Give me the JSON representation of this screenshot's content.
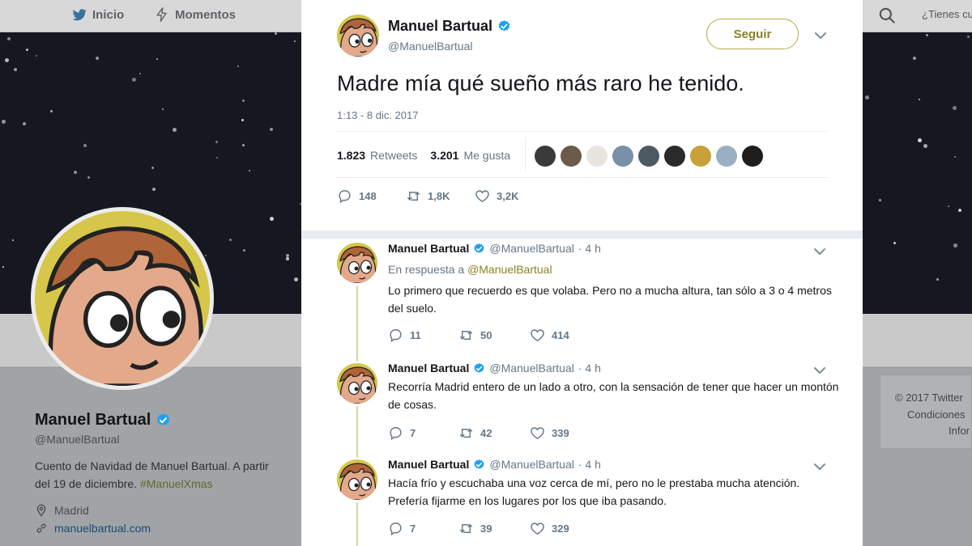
{
  "topnav": {
    "home_label": "Inicio",
    "moments_label": "Momentos",
    "right_text": "¿Tienes cu"
  },
  "profile": {
    "name": "Manuel Bartual",
    "handle": "@ManuelBartual",
    "bio": "Cuento de Navidad de Manuel Bartual. A partir del 19 de diciembre.",
    "hashtag": "#ManuelXmas",
    "location": "Madrid",
    "website": "manuelbartual.com"
  },
  "footer": {
    "copyright": "© 2017 Twitter",
    "conditions": "Condiciones",
    "info": "Infor"
  },
  "tweet": {
    "name": "Manuel Bartual",
    "handle": "@ManuelBartual",
    "follow_label": "Seguir",
    "text": "Madre mía qué sueño más raro he tenido.",
    "timestamp": "1:13 - 8 dic. 2017",
    "retweets_count": "1.823",
    "retweets_label": "Retweets",
    "likes_count": "3.201",
    "likes_label": "Me gusta",
    "reply_count": "148",
    "retweet_count_short": "1,8K",
    "like_count_short": "3,2K",
    "liker_colors": [
      "#3a3a3a",
      "#6b5b4a",
      "#e8e4df",
      "#7a8fa8",
      "#4d5a64",
      "#2a2a2a",
      "#c9a13a",
      "#9ab0c2",
      "#1e1e1e"
    ]
  },
  "replies": [
    {
      "name": "Manuel Bartual",
      "handle": "@ManuelBartual",
      "time": "· 4 h",
      "in_reply_prefix": "En respuesta a",
      "in_reply_handle": "@ManuelBartual",
      "text": "Lo primero que recuerdo es que volaba. Pero no a mucha altura, tan sólo a 3 o 4 metros del suelo.",
      "replies": "11",
      "retweets": "50",
      "likes": "414"
    },
    {
      "name": "Manuel Bartual",
      "handle": "@ManuelBartual",
      "time": "· 4 h",
      "text": "Recorría Madrid entero de un lado a otro, con la sensación de tener que hacer un montón de cosas.",
      "replies": "7",
      "retweets": "42",
      "likes": "339"
    },
    {
      "name": "Manuel Bartual",
      "handle": "@ManuelBartual",
      "time": "· 4 h",
      "text": "Hacía frío y escuchaba una voz cerca de mí, pero no le prestaba mucha atención. Prefería fijarme en los lugares por los que iba pasando.",
      "replies": "7",
      "retweets": "39",
      "likes": "329"
    }
  ],
  "colors": {
    "accent": "#8c8227",
    "verified": "#1da1f2",
    "muted": "#657786"
  }
}
